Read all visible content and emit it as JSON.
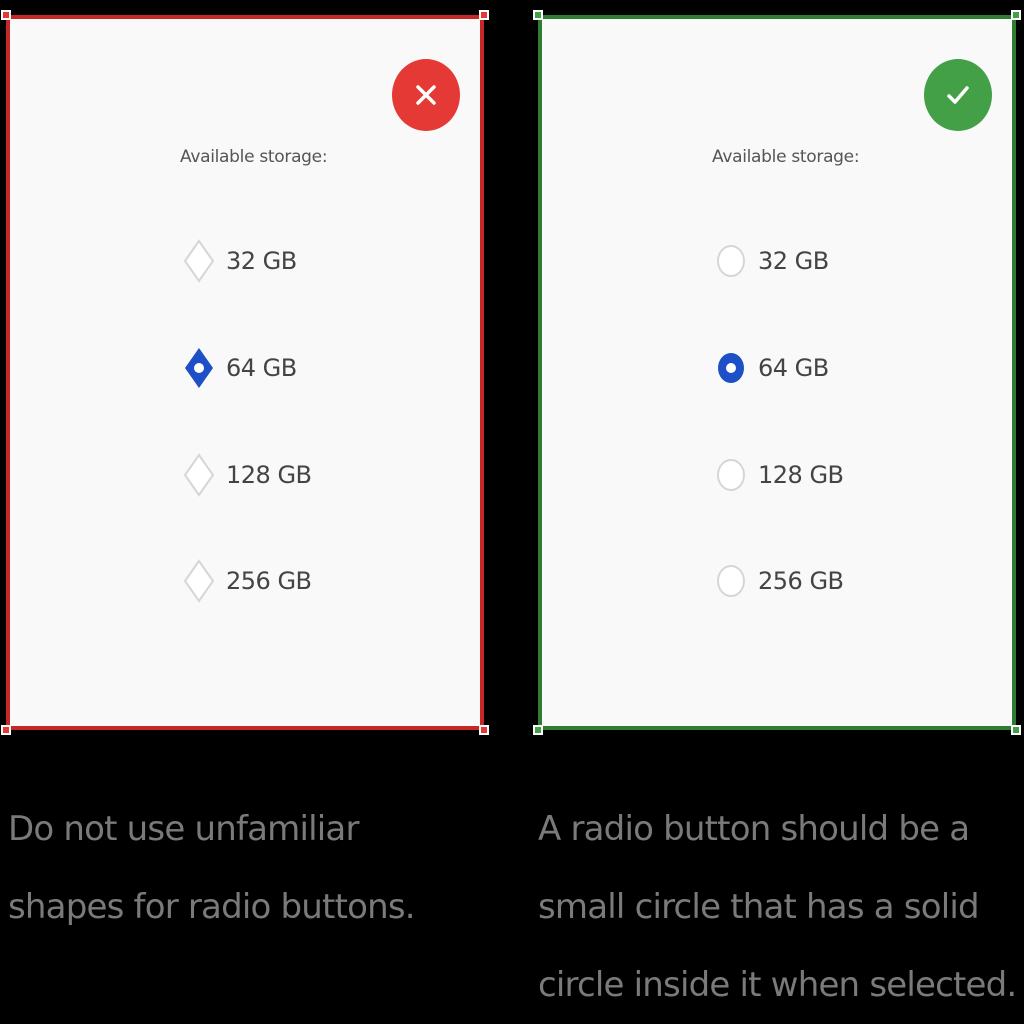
{
  "dont": {
    "status_icon": "close-icon",
    "accent_color": "#e53935",
    "storage_label": "Available storage:",
    "options": [
      {
        "label": "32 GB",
        "selected": false,
        "shape": "diamond"
      },
      {
        "label": "64 GB",
        "selected": true,
        "shape": "diamond"
      },
      {
        "label": "128 GB",
        "selected": false,
        "shape": "diamond"
      },
      {
        "label": "256 GB",
        "selected": false,
        "shape": "diamond"
      }
    ],
    "caption": "Do not use unfamiliar shapes for radio buttons."
  },
  "do": {
    "status_icon": "check-icon",
    "accent_color": "#43a047",
    "storage_label": "Available storage:",
    "options": [
      {
        "label": "32 GB",
        "selected": false,
        "shape": "circle"
      },
      {
        "label": "64 GB",
        "selected": true,
        "shape": "circle"
      },
      {
        "label": "128 GB",
        "selected": false,
        "shape": "circle"
      },
      {
        "label": "256 GB",
        "selected": false,
        "shape": "circle"
      }
    ],
    "caption": "A radio button should be a small circle that has a solid circle inside it when selected."
  },
  "selected_color": "#1e4fc7"
}
